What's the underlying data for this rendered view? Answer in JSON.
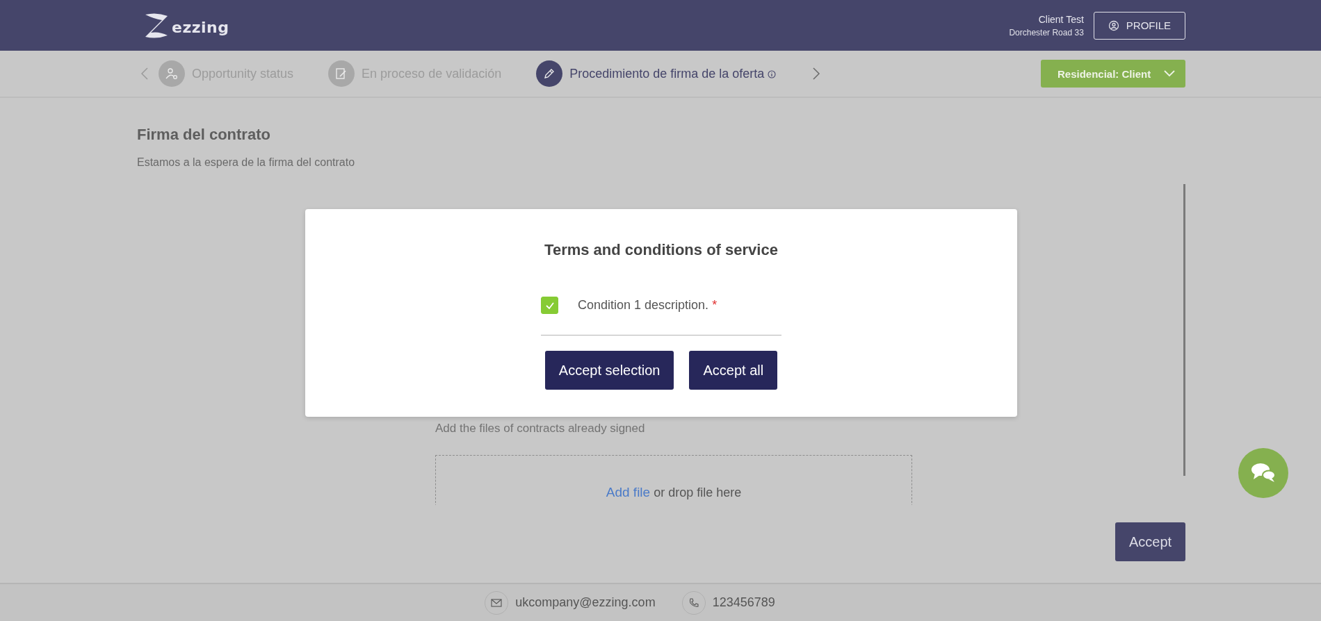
{
  "header": {
    "logo_text": "ezzing",
    "user_name": "Client Test",
    "user_address": "Dorchester Road 33",
    "profile_button": "PROFILE"
  },
  "steps": [
    {
      "label": "Opportunity status",
      "kind": "person",
      "selected": false,
      "info": false
    },
    {
      "label": "En proceso de validación",
      "kind": "document",
      "selected": false,
      "info": false
    },
    {
      "label": "Procedimiento de firma de la oferta",
      "kind": "pen",
      "selected": true,
      "info": true
    }
  ],
  "role_dropdown": {
    "label": "Residencial: Client"
  },
  "page": {
    "title": "Firma del contrato",
    "subtitle": "Estamos a la espera de la firma del contrato"
  },
  "upload": {
    "hint": "Add the files of contracts already signed",
    "link": "Add file",
    "text": "or drop file here"
  },
  "accept_button": "Accept",
  "footer": {
    "email": "ukcompany@ezzing.com",
    "phone": "123456789"
  },
  "modal": {
    "title": "Terms and conditions of service",
    "conditions": [
      {
        "label": "Condition 1 description.",
        "required_mark": "*",
        "checked": true
      }
    ],
    "buttons": [
      "Accept selection",
      "Accept all"
    ]
  }
}
